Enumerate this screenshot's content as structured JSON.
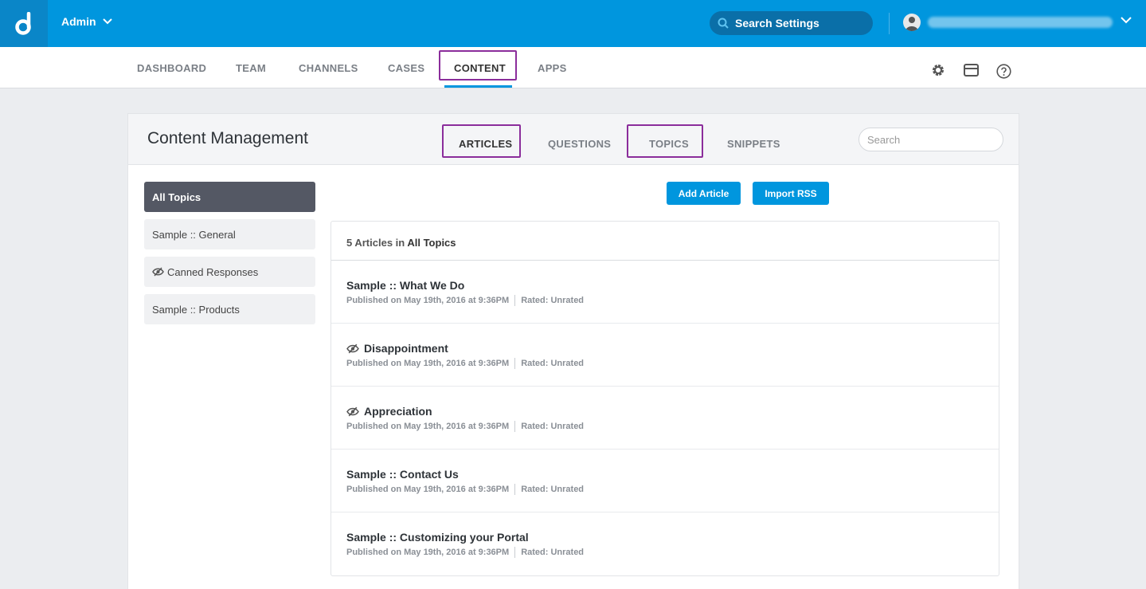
{
  "topbar": {
    "admin_label": "Admin",
    "search_placeholder": "Search Settings"
  },
  "nav": {
    "items": [
      "DASHBOARD",
      "TEAM",
      "CHANNELS",
      "CASES",
      "CONTENT",
      "APPS"
    ],
    "active": "CONTENT"
  },
  "panel": {
    "title": "Content Management",
    "tabs": [
      "ARTICLES",
      "QUESTIONS",
      "TOPICS",
      "SNIPPETS"
    ],
    "search_placeholder": "Search"
  },
  "sidebar": {
    "topics": [
      "All Topics",
      "Sample :: General",
      "Canned Responses",
      "Sample :: Products"
    ]
  },
  "buttons": {
    "add_article": "Add Article",
    "import_rss": "Import RSS"
  },
  "list": {
    "count_prefix": "5 Articles in",
    "count_topic": "All Topics",
    "articles": [
      {
        "title": "Sample :: What We Do",
        "published": "Published on May 19th, 2016 at 9:36PM",
        "rated": "Rated: Unrated",
        "hidden_icon": false
      },
      {
        "title": "Disappointment",
        "published": "Published on May 19th, 2016 at 9:36PM",
        "rated": "Rated: Unrated",
        "hidden_icon": true
      },
      {
        "title": "Appreciation",
        "published": "Published on May 19th, 2016 at 9:36PM",
        "rated": "Rated: Unrated",
        "hidden_icon": true
      },
      {
        "title": "Sample :: Contact Us",
        "published": "Published on May 19th, 2016 at 9:36PM",
        "rated": "Rated: Unrated",
        "hidden_icon": false
      },
      {
        "title": "Sample :: Customizing your Portal",
        "published": "Published on May 19th, 2016 at 9:36PM",
        "rated": "Rated: Unrated",
        "hidden_icon": false
      }
    ]
  },
  "colors": {
    "brand_blue": "#0096de",
    "highlight_purple": "#8b2d9b",
    "active_topic": "#545864"
  }
}
